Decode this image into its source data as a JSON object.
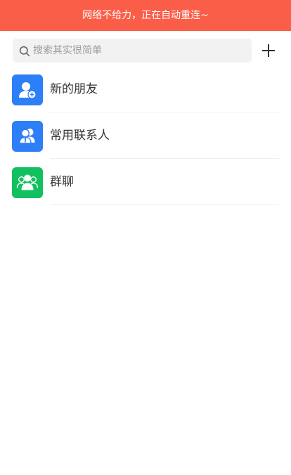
{
  "banner": {
    "text": "网络不给力，正在自动重连~"
  },
  "search": {
    "placeholder": "搜索其实很简单",
    "value": ""
  },
  "header": {
    "add_icon": "plus-icon"
  },
  "contacts": {
    "items": [
      {
        "label": "新的朋友",
        "icon": "new-friend-icon",
        "color": "#2c7ff7"
      },
      {
        "label": "常用联系人",
        "icon": "frequent-contacts-icon",
        "color": "#2c7ff7"
      },
      {
        "label": "群聊",
        "icon": "group-chat-icon",
        "color": "#12c05f"
      }
    ]
  },
  "colors": {
    "banner_bg": "#fb5e48",
    "search_bg": "#f2f2f2",
    "accent_blue": "#2c7ff7",
    "accent_green": "#12c05f"
  }
}
